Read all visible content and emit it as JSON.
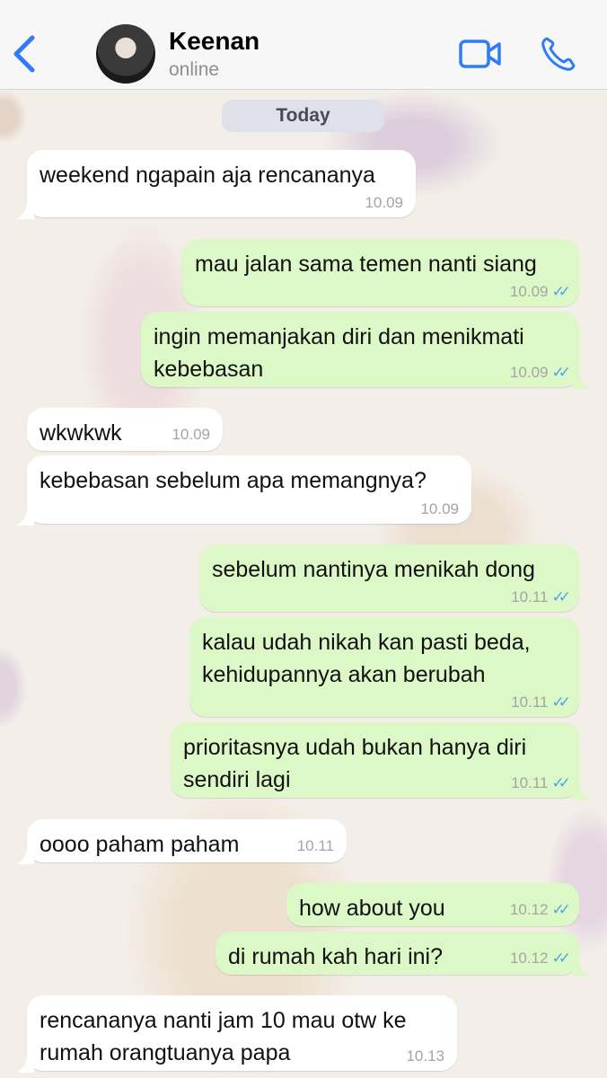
{
  "header": {
    "contact_name": "Keenan",
    "status": "online"
  },
  "date_chip": "Today",
  "messages": [
    {
      "dir": "in",
      "text": "weekend ngapain aja rencananya",
      "time": "10.09"
    },
    {
      "dir": "out",
      "text": "mau jalan sama temen nanti siang",
      "time": "10.09"
    },
    {
      "dir": "out",
      "text": "ingin memanjakan diri dan menikmati kebebasan",
      "time": "10.09"
    },
    {
      "dir": "in",
      "text": "wkwkwk",
      "time": "10.09"
    },
    {
      "dir": "in",
      "text": "kebebasan sebelum apa memangnya?",
      "time": "10.09"
    },
    {
      "dir": "out",
      "text": "sebelum nantinya menikah dong",
      "time": "10.11"
    },
    {
      "dir": "out",
      "text": "kalau udah nikah kan pasti beda, kehidupannya akan berubah",
      "time": "10.11"
    },
    {
      "dir": "out",
      "text": "prioritasnya udah bukan hanya diri sendiri lagi",
      "time": "10.11"
    },
    {
      "dir": "in",
      "text": "oooo paham paham",
      "time": "10.11"
    },
    {
      "dir": "out",
      "text": "how about you",
      "time": "10.12"
    },
    {
      "dir": "out",
      "text": "di rumah kah hari ini?",
      "time": "10.12"
    },
    {
      "dir": "in",
      "text": "rencananya nanti jam 10 mau otw ke rumah orangtuanya papa",
      "time": "10.13"
    }
  ],
  "colors": {
    "accent": "#2e7cf6",
    "incoming_bubble": "#ffffff",
    "outgoing_bubble": "#dcf8c6",
    "read_ticks": "#4fa3e8"
  }
}
